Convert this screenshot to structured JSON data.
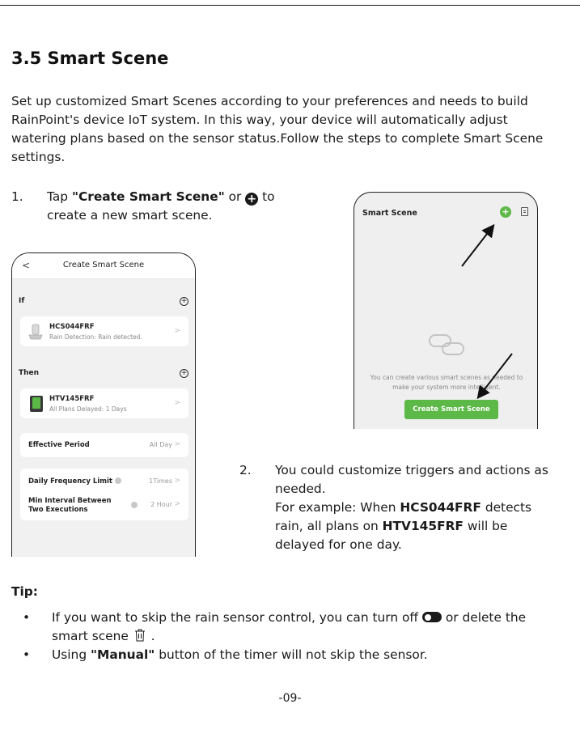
{
  "heading": "3.5 Smart Scene",
  "intro": "Set up customized Smart Scenes according to your preferences and needs to build RainPoint's device IoT system. In this way, your device will automatically adjust watering plans based on the sensor status.Follow the steps to complete Smart Scene settings.",
  "step1": {
    "number": "1.",
    "prefix": "Tap ",
    "bold": "\"Create Smart Scene\"",
    "mid": " or ",
    "suffix": " to create a new smart scene.",
    "plus_icon": "plus-circle-icon"
  },
  "left_phone": {
    "back": "<",
    "title": "Create Smart Scene",
    "if_label": "If",
    "then_label": "Then",
    "if_device": {
      "name": "HCS044FRF",
      "sub": "Rain Detection: Rain detected."
    },
    "then_device": {
      "name": "HTV145FRF",
      "sub": "All Plans Delayed: 1 Days"
    },
    "effective_period": {
      "label": "Effective Period",
      "value": "All Day"
    },
    "daily_frequency": {
      "label": "Daily Frequency Limit",
      "value": "1Times"
    },
    "min_interval": {
      "label": "Min Interval Between Two Executions",
      "value": "2 Hour"
    },
    "chevron": ">"
  },
  "right_phone": {
    "title": "Smart Scene",
    "plus": "+",
    "desc": "You can create various smart scenes as needed to make your system more intelligent.",
    "button": "Create Smart Scene",
    "accent": "#5cb847"
  },
  "step2": {
    "number": "2.",
    "line1": "You could customize triggers and actions as needed.",
    "ex_prefix": "For example: When ",
    "ex_bold1": "HCS044FRF",
    "ex_mid": " detects rain, all plans on ",
    "ex_bold2": "HTV145FRF",
    "ex_suffix": " will be delayed for one day."
  },
  "tip": {
    "title": "Tip:",
    "bullet": "•",
    "item1_prefix": "If you want to skip the rain sensor control, you can turn off ",
    "item1_mid": " or delete the smart scene ",
    "item1_suffix": " .",
    "item2_prefix": "Using ",
    "item2_bold": "\"Manual\"",
    "item2_suffix": " button of the timer will not skip the sensor."
  },
  "page_number": "-09-"
}
